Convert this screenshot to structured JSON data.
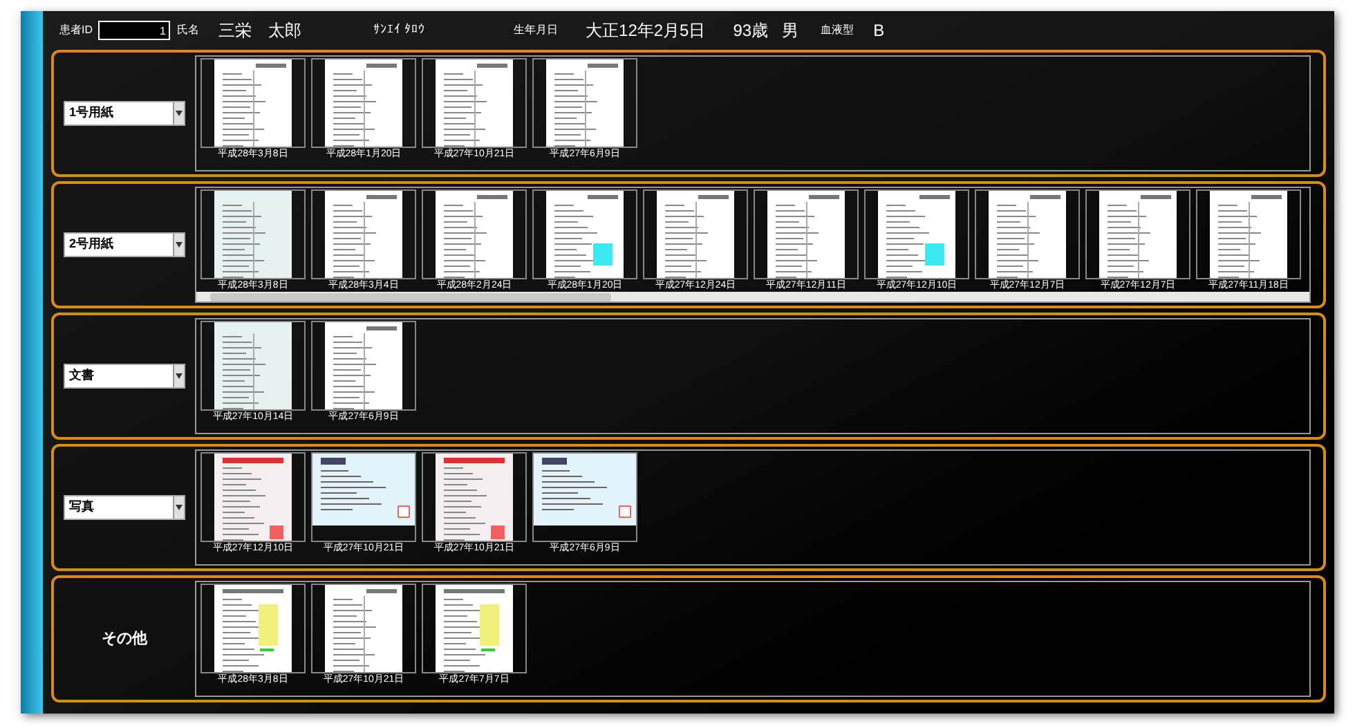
{
  "header": {
    "patient_id_label": "患者ID",
    "patient_id": "1",
    "name_label": "氏名",
    "name": "三栄　太郎",
    "kana": "ｻﾝｴｲ ﾀﾛｳ",
    "birth_label": "生年月日",
    "birth": "大正12年2月5日",
    "age": "93歳",
    "sex": "男",
    "blood_label": "血液型",
    "blood": "B"
  },
  "sections": [
    {
      "kind": "dropdown",
      "label": "1号用紙",
      "scrollable": false,
      "thumbnails": [
        {
          "kind": "form",
          "date": "平成28年3月8日"
        },
        {
          "kind": "form",
          "date": "平成28年1月20日"
        },
        {
          "kind": "form",
          "date": "平成27年10月21日"
        },
        {
          "kind": "form",
          "date": "平成27年6月9日"
        }
      ]
    },
    {
      "kind": "dropdown",
      "label": "2号用紙",
      "scrollable": true,
      "thumbnails": [
        {
          "kind": "tinted",
          "date": "平成28年3月8日"
        },
        {
          "kind": "form",
          "date": "平成28年3月4日"
        },
        {
          "kind": "form",
          "date": "平成28年2月24日"
        },
        {
          "kind": "marked",
          "date": "平成28年1月20日"
        },
        {
          "kind": "form",
          "date": "平成27年12月24日"
        },
        {
          "kind": "form",
          "date": "平成27年12月11日"
        },
        {
          "kind": "marked",
          "date": "平成27年12月10日"
        },
        {
          "kind": "form",
          "date": "平成27年12月7日"
        },
        {
          "kind": "form",
          "date": "平成27年12月7日"
        },
        {
          "kind": "form",
          "date": "平成27年11月18日"
        }
      ]
    },
    {
      "kind": "dropdown",
      "label": "文書",
      "scrollable": false,
      "thumbnails": [
        {
          "kind": "tinted",
          "date": "平成27年10月14日"
        },
        {
          "kind": "form",
          "date": "平成27年6月9日"
        }
      ]
    },
    {
      "kind": "dropdown",
      "label": "写真",
      "scrollable": false,
      "thumbnails": [
        {
          "kind": "slip",
          "date": "平成27年12月10日"
        },
        {
          "kind": "ticket",
          "date": "平成27年10月21日"
        },
        {
          "kind": "slip",
          "date": "平成27年10月21日"
        },
        {
          "kind": "ticket",
          "date": "平成27年6月9日"
        }
      ]
    },
    {
      "kind": "label",
      "label": "その他",
      "scrollable": false,
      "thumbnails": [
        {
          "kind": "report",
          "date": "平成28年3月8日"
        },
        {
          "kind": "form",
          "date": "平成27年10月21日"
        },
        {
          "kind": "report",
          "date": "平成27年7月7日"
        }
      ]
    }
  ]
}
